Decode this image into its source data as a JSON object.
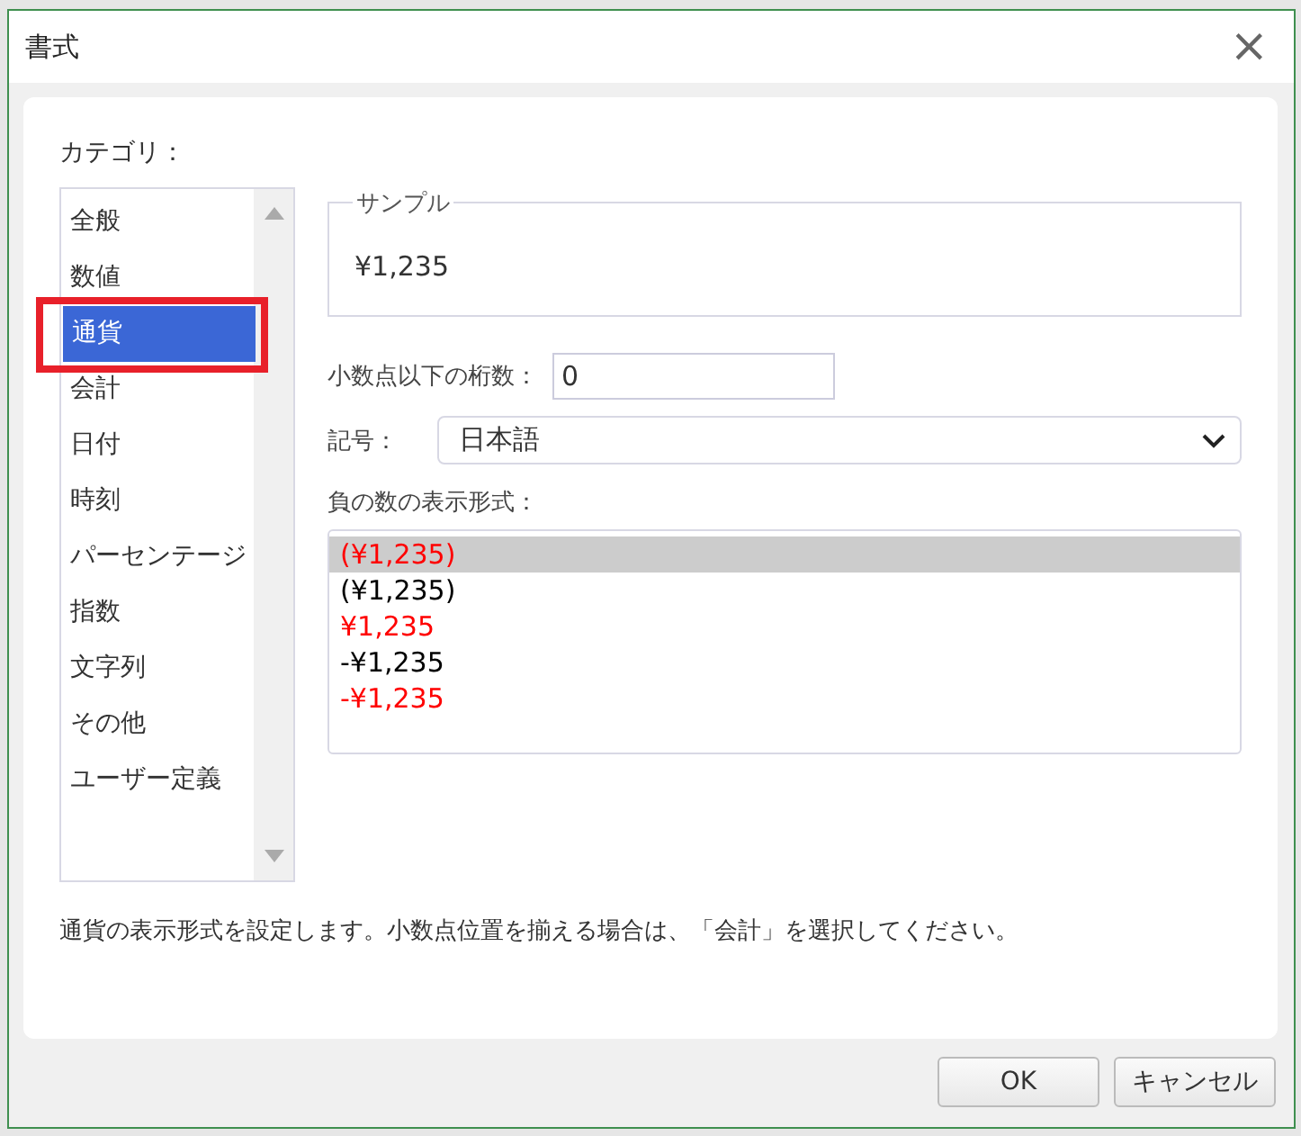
{
  "window": {
    "title": "書式",
    "close": "×"
  },
  "category_label": "カテゴリ：",
  "categories": [
    {
      "label": "全般",
      "selected": false
    },
    {
      "label": "数値",
      "selected": false
    },
    {
      "label": "通貨",
      "selected": true,
      "highlighted": true
    },
    {
      "label": "会計",
      "selected": false
    },
    {
      "label": "日付",
      "selected": false
    },
    {
      "label": "時刻",
      "selected": false
    },
    {
      "label": "パーセンテージ",
      "selected": false
    },
    {
      "label": "指数",
      "selected": false
    },
    {
      "label": "文字列",
      "selected": false
    },
    {
      "label": "その他",
      "selected": false
    },
    {
      "label": "ユーザー定義",
      "selected": false
    }
  ],
  "sample": {
    "legend": "サンプル",
    "value": "¥1,235"
  },
  "decimal_places": {
    "label": "小数点以下の桁数：",
    "value": "0"
  },
  "symbol": {
    "label": "記号：",
    "value": "日本語"
  },
  "negative_format": {
    "label": "負の数の表示形式：",
    "items": [
      {
        "text": "(¥1,235)",
        "color": "#ff0000",
        "selected": true
      },
      {
        "text": "(¥1,235)",
        "color": "#000000",
        "selected": false
      },
      {
        "text": "¥1,235",
        "color": "#ff0000",
        "selected": false
      },
      {
        "text": "-¥1,235",
        "color": "#000000",
        "selected": false
      },
      {
        "text": "-¥1,235",
        "color": "#ff0000",
        "selected": false
      }
    ]
  },
  "description": "通貨の表示形式を設定します。小数点位置を揃える場合は、「会計」を選択してください。",
  "buttons": [
    "OK",
    "キャンセル"
  ]
}
